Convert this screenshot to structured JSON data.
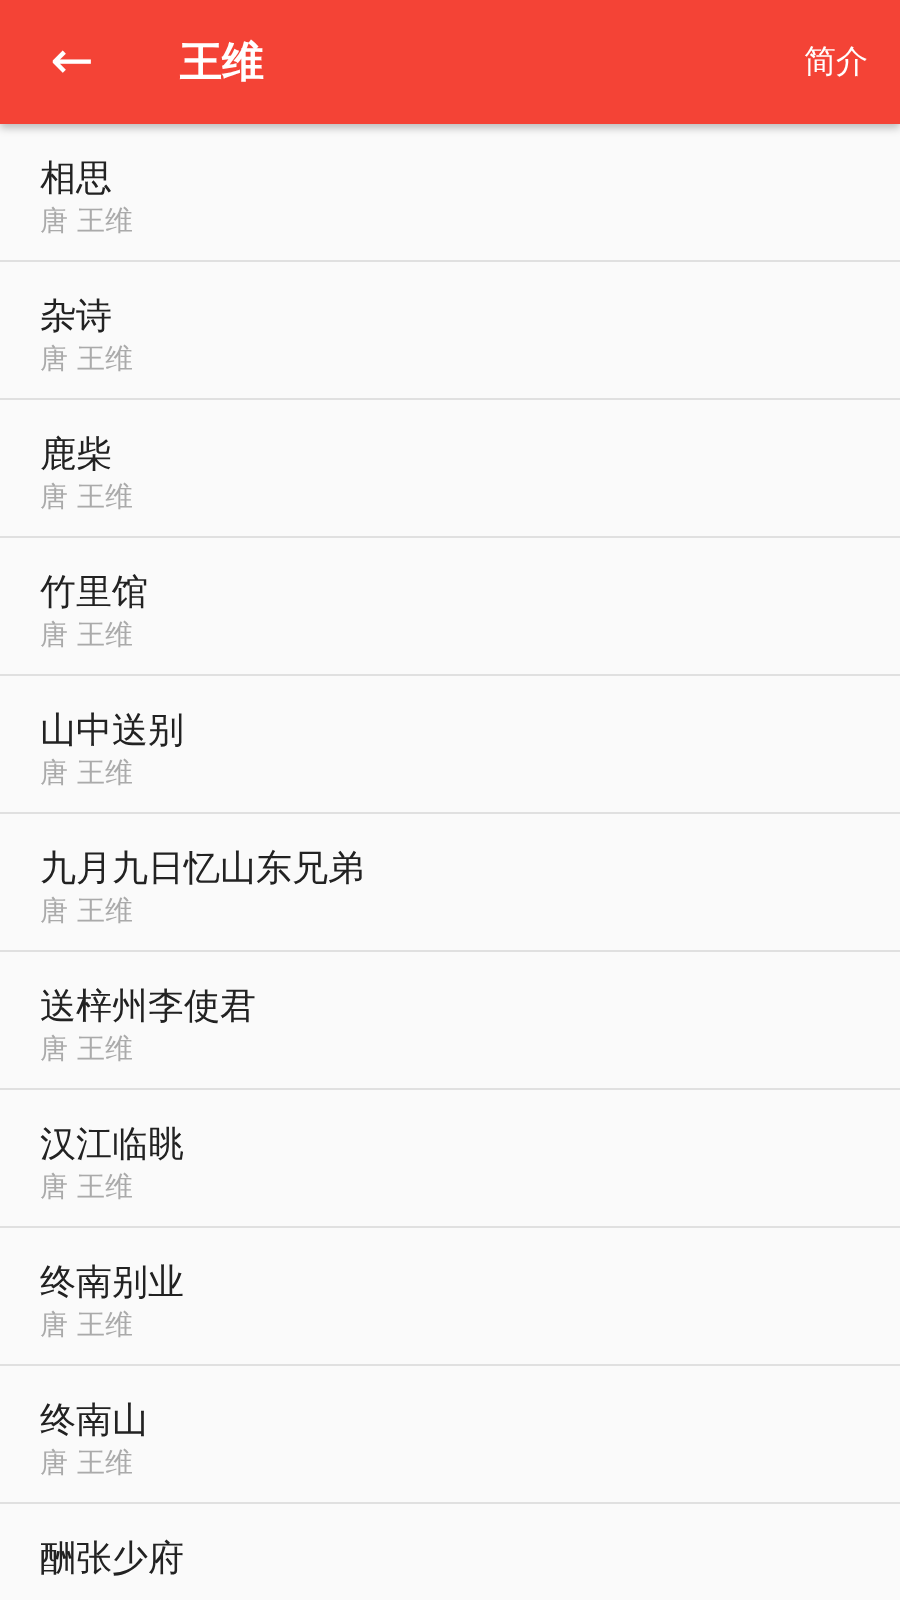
{
  "header": {
    "back": "←",
    "title": "王维",
    "action": "简介"
  },
  "poems": [
    {
      "title": "相思",
      "subtitle": "唐 王维"
    },
    {
      "title": "杂诗",
      "subtitle": "唐 王维"
    },
    {
      "title": "鹿柴",
      "subtitle": "唐 王维"
    },
    {
      "title": "竹里馆",
      "subtitle": "唐 王维"
    },
    {
      "title": "山中送别",
      "subtitle": "唐 王维"
    },
    {
      "title": "九月九日忆山东兄弟",
      "subtitle": "唐 王维"
    },
    {
      "title": "送梓州李使君",
      "subtitle": "唐 王维"
    },
    {
      "title": "汉江临眺",
      "subtitle": "唐 王维"
    },
    {
      "title": "终南别业",
      "subtitle": "唐 王维"
    },
    {
      "title": "终南山",
      "subtitle": "唐 王维"
    },
    {
      "title": "酬张少府"
    }
  ]
}
